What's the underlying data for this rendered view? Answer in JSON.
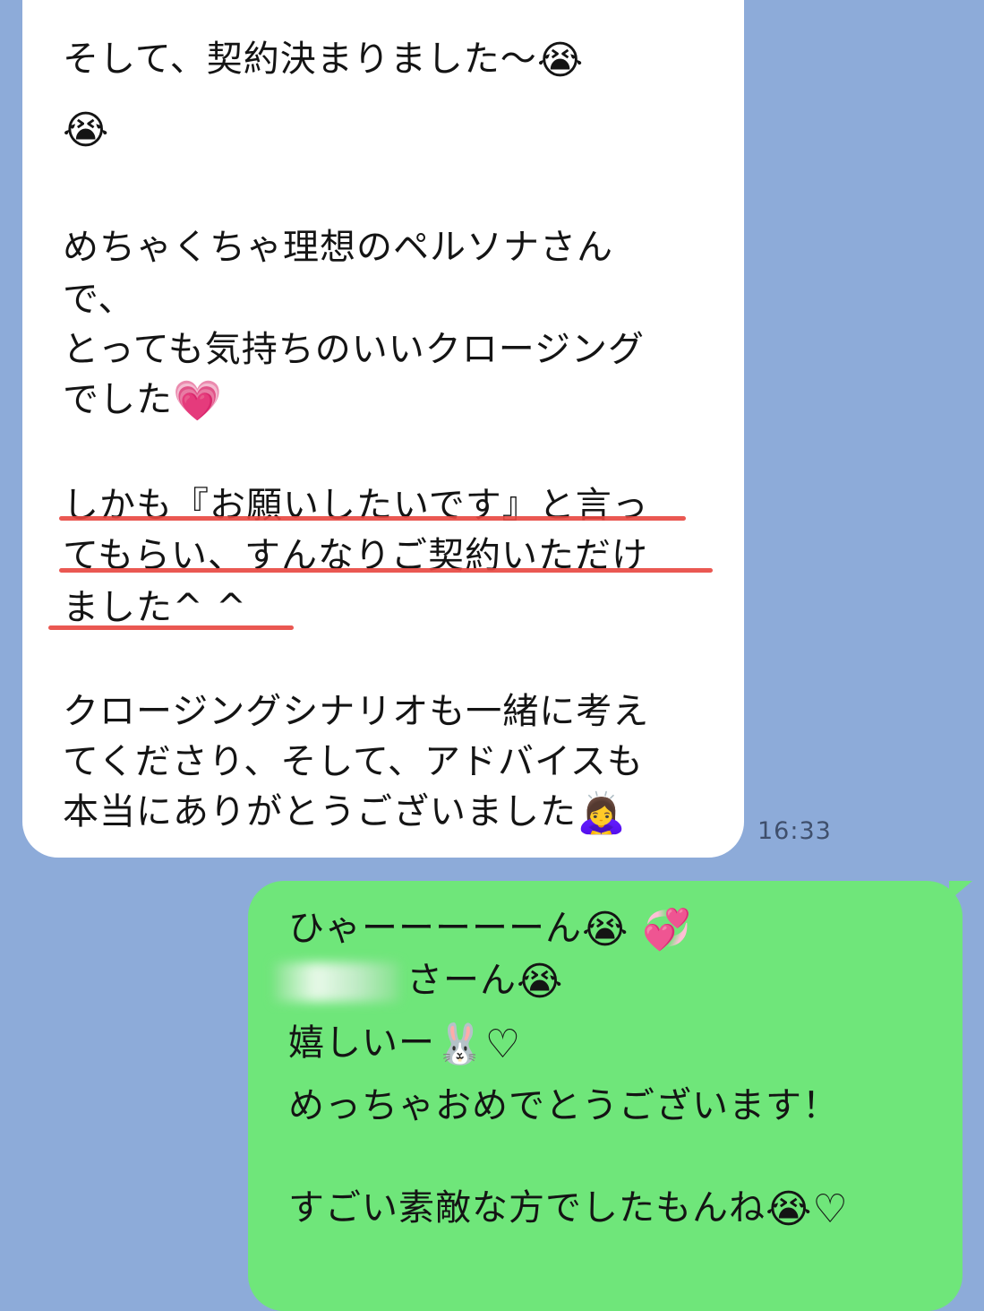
{
  "incoming": {
    "lines": [
      {
        "text": "そして、契約決まりました〜",
        "emoji": "😭"
      },
      {
        "text": "",
        "emoji": "😭"
      },
      {
        "text": "めちゃくちゃ理想のペルソナさん",
        "emoji": ""
      },
      {
        "text": "で、",
        "emoji": ""
      },
      {
        "text": "とっても気持ちのいいクロージング",
        "emoji": ""
      },
      {
        "text": "でした",
        "emoji": "💗"
      },
      {
        "text": "しかも『お願いしたいです』と言っ",
        "emoji": ""
      },
      {
        "text": "てもらい、すんなりご契約いただけ",
        "emoji": ""
      },
      {
        "text": "ました^ ^",
        "emoji": ""
      },
      {
        "text": "クロージングシナリオも一緒に考え",
        "emoji": ""
      },
      {
        "text": "てくださり、そして、アドバイスも",
        "emoji": ""
      },
      {
        "text": "本当にありがとうございました",
        "emoji": "🙇‍♀️"
      }
    ],
    "timestamp": "16:33"
  },
  "outgoing": {
    "lines": [
      {
        "text": "ひゃーーーーーん",
        "emoji": "😭 💞"
      },
      {
        "text": "さーん",
        "emoji": "😭"
      },
      {
        "text": "嬉しいー",
        "emoji": "🐰♡"
      },
      {
        "text": "めっちゃおめでとうございます！",
        "emoji": ""
      },
      {
        "text": "すごい素敵な方でしたもんね",
        "emoji": "😭♡"
      }
    ]
  },
  "colors": {
    "background": "#8dabd9",
    "incoming_bubble": "#ffffff",
    "outgoing_bubble": "#6fe67a",
    "underline": "#e8463f"
  }
}
